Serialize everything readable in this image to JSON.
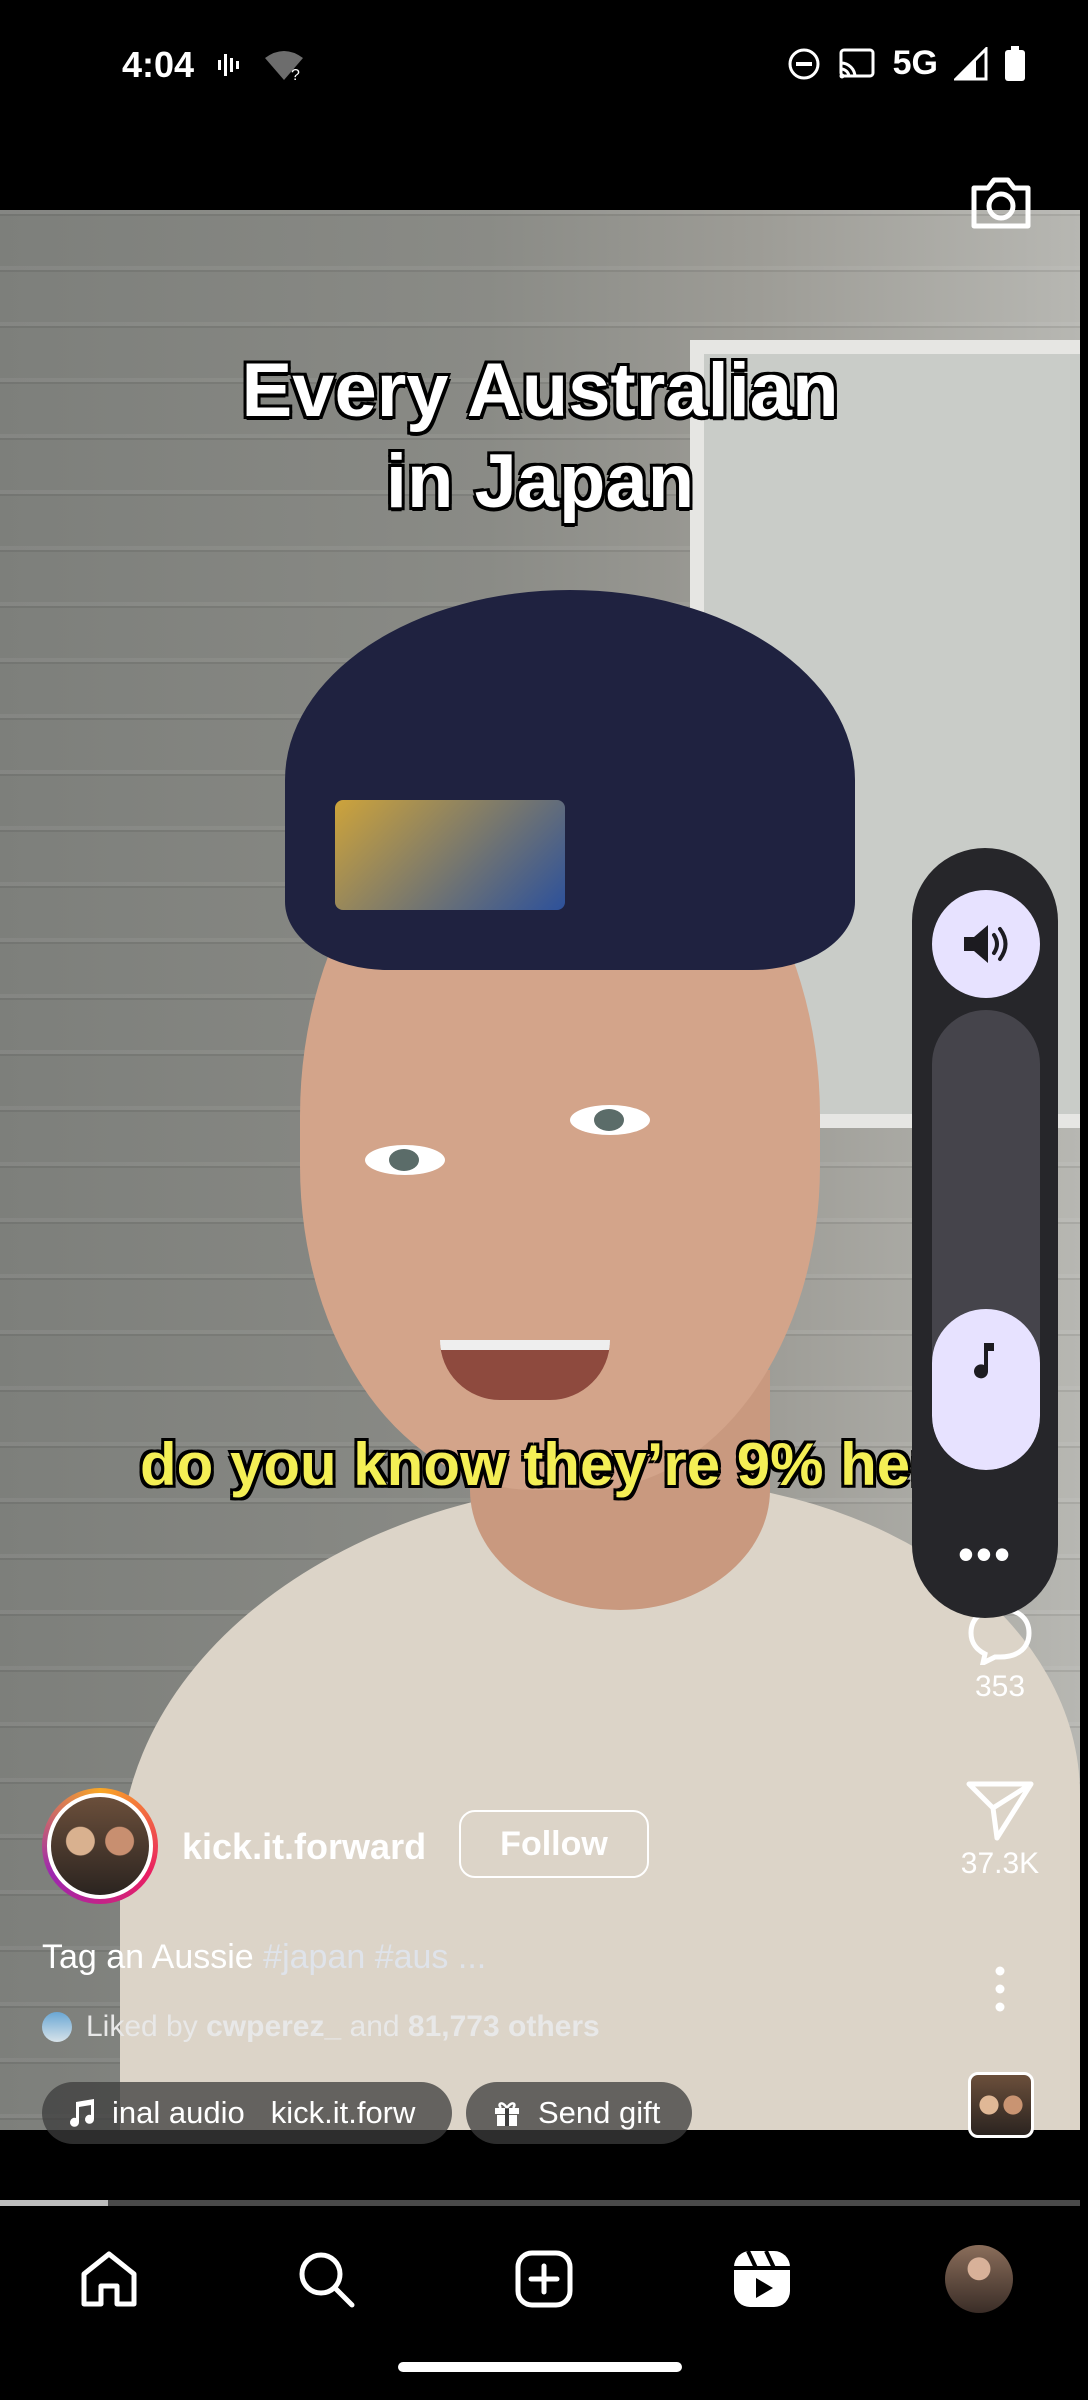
{
  "status_bar": {
    "time": "4:04",
    "network": "5G"
  },
  "video": {
    "title_lines": [
      "Every Australian",
      "in Japan"
    ],
    "subtitle": "do you know they’re 9% here?",
    "progress": 0.1
  },
  "actions": {
    "comments_count": "353",
    "shares_count": "37.3K"
  },
  "volume": {
    "level": 0.35
  },
  "post": {
    "username": "kick.it.forward",
    "follow_label": "Follow",
    "caption_text": "Tag an Aussie",
    "caption_tags": "#japan #aus ...",
    "liked_by_prefix": "Liked by",
    "liked_by_user": "cwperez_",
    "liked_by_and": "and",
    "liked_by_others": "81,773 others",
    "audio_label": "inal audio",
    "audio_author": "kick.it.forw",
    "gift_label": "Send gift"
  },
  "icons": {
    "status": [
      "voice-icon",
      "wifi-unknown-icon",
      "do-not-disturb-icon",
      "cast-icon",
      "signal-icon",
      "battery-icon"
    ],
    "nav": [
      "home-icon",
      "search-icon",
      "create-icon",
      "reels-icon",
      "profile-icon"
    ]
  }
}
